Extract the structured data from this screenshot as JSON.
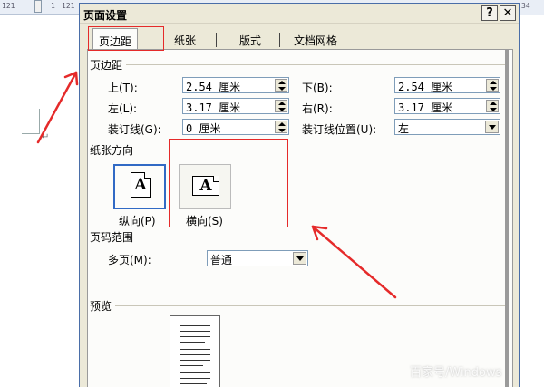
{
  "ruler": {
    "left_ticks": [
      "121",
      "1",
      "121"
    ],
    "right_tick": "34"
  },
  "dialog": {
    "title": "页面设置",
    "help_label": "?",
    "close_label": "✕"
  },
  "tabs": [
    {
      "label": "页边距",
      "active": true
    },
    {
      "label": "纸张",
      "active": false
    },
    {
      "label": "版式",
      "active": false
    },
    {
      "label": "文档网格",
      "active": false
    }
  ],
  "margins": {
    "group_label": "页边距",
    "top_label": "上(T):",
    "top_value": "2.54 厘米",
    "bottom_label": "下(B):",
    "bottom_value": "2.54 厘米",
    "left_label": "左(L):",
    "left_value": "3.17 厘米",
    "right_label": "右(R):",
    "right_value": "3.17 厘米",
    "gutter_label": "装订线(G):",
    "gutter_value": "0 厘米",
    "gutter_pos_label": "装订线位置(U):",
    "gutter_pos_value": "左"
  },
  "orientation": {
    "group_label": "纸张方向",
    "portrait_label": "纵向(P)",
    "landscape_label": "横向(S)",
    "portrait_glyph": "A",
    "landscape_glyph": "A",
    "selected": "portrait"
  },
  "pages": {
    "group_label": "页码范围",
    "multi_label": "多页(M):",
    "multi_value": "普通"
  },
  "preview": {
    "group_label": "预览"
  },
  "watermark": "百家号/Windows"
}
